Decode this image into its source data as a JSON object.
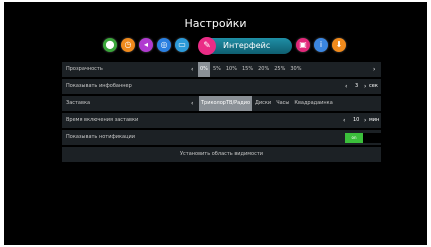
{
  "title": "Настройки",
  "categories": {
    "icons": [
      {
        "name": "network-icon",
        "glyph": "⬤",
        "color": "#3aa63a"
      },
      {
        "name": "clock-icon",
        "glyph": "◷",
        "color": "#f08a1c"
      },
      {
        "name": "audio-icon",
        "glyph": "◂",
        "color": "#b03ad0"
      },
      {
        "name": "globe-icon",
        "glyph": "◎",
        "color": "#2a7fe0"
      },
      {
        "name": "screen-icon",
        "glyph": "▭",
        "color": "#2c9ad8"
      }
    ],
    "active_label": "Интерфейс",
    "right_icons": [
      {
        "name": "lock-icon",
        "glyph": "▣",
        "color": "#e2287a"
      },
      {
        "name": "info-icon",
        "glyph": "i",
        "color": "#3b86e0"
      },
      {
        "name": "download-icon",
        "glyph": "⬇",
        "color": "#f08a1c"
      }
    ]
  },
  "settings": {
    "transparency": {
      "label": "Прозрачность",
      "options": [
        "0%",
        "5%",
        "10%",
        "15%",
        "20%",
        "25%",
        "30%"
      ],
      "selected": "0%"
    },
    "infobanner": {
      "label": "Показывать инфобаннер",
      "value": "3",
      "unit": "сек"
    },
    "screensaver": {
      "label": "Заставка",
      "options": [
        "ТриколорТВ/Радио",
        "Диски",
        "Часы",
        "Квадрадаинка"
      ],
      "selected": "ТриколорТВ/Радио"
    },
    "screensaver_delay": {
      "label": "Время включения заставки",
      "value": "10",
      "unit": "мин"
    },
    "notifications": {
      "label": "Показывать нотификации",
      "state": "on"
    },
    "visibility_area": {
      "label": "Установить область видимости"
    }
  }
}
